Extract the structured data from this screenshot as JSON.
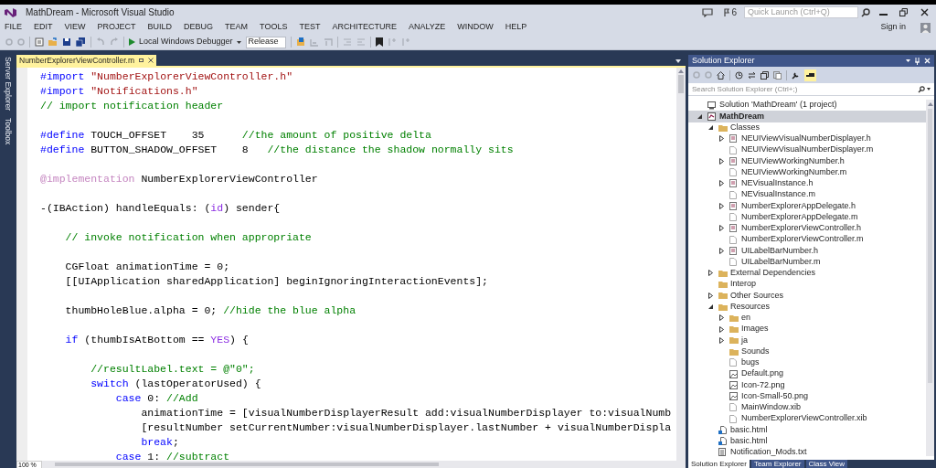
{
  "window": {
    "title": "MathDream - Microsoft Visual Studio"
  },
  "title_bar": {
    "notification_count": "6",
    "quick_launch": {
      "placeholder": "Quick Launch (Ctrl+Q)"
    },
    "sign_in": "Sign in"
  },
  "menu": [
    "FILE",
    "EDIT",
    "VIEW",
    "PROJECT",
    "BUILD",
    "DEBUG",
    "TEAM",
    "TOOLS",
    "TEST",
    "ARCHITECTURE",
    "ANALYZE",
    "WINDOW",
    "HELP"
  ],
  "toolbar": {
    "debug_target": "Local Windows Debugger",
    "configuration": "Release"
  },
  "side_tabs": [
    "Server Explorer",
    "Toolbox"
  ],
  "editor": {
    "tabs": [
      {
        "label": "NumberExplorerViewController.m",
        "selected": true
      }
    ],
    "blocks": [
      [
        [
          {
            "kind": "directive",
            "text": "#import "
          },
          {
            "kind": "string",
            "text": "\"NumberExplorerViewController.h\""
          }
        ],
        [
          {
            "kind": "directive",
            "text": "#import "
          },
          {
            "kind": "string",
            "text": "\"Notifications.h\""
          }
        ],
        [
          {
            "kind": "comment",
            "text": "// import notification header"
          }
        ]
      ],
      [
        [
          {
            "kind": "directive",
            "text": "#define "
          },
          {
            "kind": "plain",
            "text": "TOUCH_OFFSET    35      "
          },
          {
            "kind": "comment",
            "text": "//the amount of positive delta"
          }
        ],
        [
          {
            "kind": "directive",
            "text": "#define "
          },
          {
            "kind": "plain",
            "text": "BUTTON_SHADOW_OFFSET    8   "
          },
          {
            "kind": "comment",
            "text": "//the distance the shadow normally sits"
          }
        ]
      ],
      [
        [
          {
            "kind": "attribute",
            "text": "@implementation "
          },
          {
            "kind": "plain",
            "text": "NumberExplorerViewController"
          }
        ]
      ],
      [
        [
          {
            "kind": "plain",
            "text": "-(IBAction) handleEquals: ("
          },
          {
            "kind": "constant",
            "text": "id"
          },
          {
            "kind": "plain",
            "text": ") sender{"
          }
        ]
      ],
      [
        [
          {
            "kind": "comment",
            "text": "    // invoke notification when appropriate"
          }
        ]
      ],
      [
        [
          {
            "kind": "plain",
            "text": "    CGFloat animationTime = 0;"
          }
        ],
        [
          {
            "kind": "plain",
            "text": "    [[UIApplication sharedApplication] beginIgnoringInteractionEvents];"
          }
        ]
      ],
      [
        [
          {
            "kind": "plain",
            "text": "    thumbHoleBlue.alpha = 0; "
          },
          {
            "kind": "comment",
            "text": "//hide the blue alpha"
          }
        ]
      ],
      [
        [
          {
            "kind": "keyword",
            "text": "    if"
          },
          {
            "kind": "plain",
            "text": " (thumbIsAtBottom == "
          },
          {
            "kind": "constant",
            "text": "YES"
          },
          {
            "kind": "plain",
            "text": ") {"
          }
        ]
      ],
      [
        [
          {
            "kind": "comment",
            "text": "        //resultLabel.text = @\"0\";"
          }
        ],
        [
          {
            "kind": "keyword",
            "text": "        switch"
          },
          {
            "kind": "plain",
            "text": " (lastOperatorUsed) {"
          }
        ],
        [
          {
            "kind": "keyword",
            "text": "            case"
          },
          {
            "kind": "plain",
            "text": " 0: "
          },
          {
            "kind": "comment",
            "text": "//Add"
          }
        ],
        [
          {
            "kind": "plain",
            "text": "                animationTime = [visualNumberDisplayerResult add:visualNumberDisplayer to:visualNumb"
          }
        ],
        [
          {
            "kind": "plain",
            "text": "                [resultNumber setCurrentNumber:visualNumberDisplayer.lastNumber + visualNumberDispla"
          }
        ],
        [
          {
            "kind": "keyword",
            "text": "                break"
          },
          {
            "kind": "plain",
            "text": ";"
          }
        ],
        [
          {
            "kind": "keyword",
            "text": "            case"
          },
          {
            "kind": "plain",
            "text": " 1: "
          },
          {
            "kind": "comment",
            "text": "//subtract"
          }
        ]
      ]
    ],
    "zoom": "100 %"
  },
  "solution_explorer": {
    "title": "Solution Explorer",
    "search": {
      "placeholder": "Search Solution Explorer (Ctrl+;)"
    },
    "tree": [
      {
        "label": "Solution 'MathDream' (1 project)",
        "kind": "solution",
        "selected": false
      },
      {
        "label": "MathDream",
        "kind": "project",
        "selected": true,
        "expanded": true,
        "children": [
          {
            "label": "Classes",
            "kind": "folder",
            "selected": false,
            "expanded": true,
            "children": [
              {
                "label": "NEUIViewVisualNumberDisplayer.h",
                "kind": "header",
                "selected": false,
                "expanded": false
              },
              {
                "label": "NEUIViewVisualNumberDisplayer.m",
                "kind": "file",
                "selected": false
              },
              {
                "label": "NEUIViewWorkingNumber.h",
                "kind": "header",
                "selected": false,
                "expanded": false
              },
              {
                "label": "NEUIViewWorkingNumber.m",
                "kind": "file",
                "selected": false
              },
              {
                "label": "NEVisualInstance.h",
                "kind": "header",
                "selected": false,
                "expanded": false
              },
              {
                "label": "NEVisualInstance.m",
                "kind": "file",
                "selected": false
              },
              {
                "label": "NumberExplorerAppDelegate.h",
                "kind": "header",
                "selected": false,
                "expanded": false
              },
              {
                "label": "NumberExplorerAppDelegate.m",
                "kind": "file",
                "selected": false
              },
              {
                "label": "NumberExplorerViewController.h",
                "kind": "header",
                "selected": false,
                "expanded": false
              },
              {
                "label": "NumberExplorerViewController.m",
                "kind": "file",
                "selected": false
              },
              {
                "label": "UILabelBarNumber.h",
                "kind": "header",
                "selected": false,
                "expanded": false
              },
              {
                "label": "UILabelBarNumber.m",
                "kind": "file",
                "selected": false
              }
            ]
          },
          {
            "label": "External Dependencies",
            "kind": "folder",
            "selected": false,
            "expanded": false
          },
          {
            "label": "Interop",
            "kind": "folder",
            "selected": false
          },
          {
            "label": "Other Sources",
            "kind": "folder",
            "selected": false,
            "expanded": false
          },
          {
            "label": "Resources",
            "kind": "folder",
            "selected": false,
            "expanded": true,
            "children": [
              {
                "label": "en",
                "kind": "folder",
                "selected": false,
                "expanded": false
              },
              {
                "label": "Images",
                "kind": "folder",
                "selected": false,
                "expanded": false
              },
              {
                "label": "ja",
                "kind": "folder",
                "selected": false,
                "expanded": false
              },
              {
                "label": "Sounds",
                "kind": "folder",
                "selected": false
              },
              {
                "label": "bugs",
                "kind": "file",
                "selected": false
              },
              {
                "label": "Default.png",
                "kind": "image",
                "selected": false
              },
              {
                "label": "Icon-72.png",
                "kind": "image",
                "selected": false
              },
              {
                "label": "Icon-Small-50.png",
                "kind": "image",
                "selected": false
              },
              {
                "label": "MainWindow.xib",
                "kind": "file",
                "selected": false
              },
              {
                "label": "NumberExplorerViewController.xib",
                "kind": "file",
                "selected": false
              }
            ]
          },
          {
            "label": "basic.html",
            "kind": "html",
            "selected": false
          },
          {
            "label": "basic.html",
            "kind": "html",
            "selected": false
          },
          {
            "label": "Notification_Mods.txt",
            "kind": "text",
            "selected": false
          }
        ]
      }
    ],
    "bottom_tabs": [
      {
        "label": "Solution Explorer",
        "selected": true
      },
      {
        "label": "Team Explorer",
        "selected": false
      },
      {
        "label": "Class View",
        "selected": false
      }
    ]
  }
}
